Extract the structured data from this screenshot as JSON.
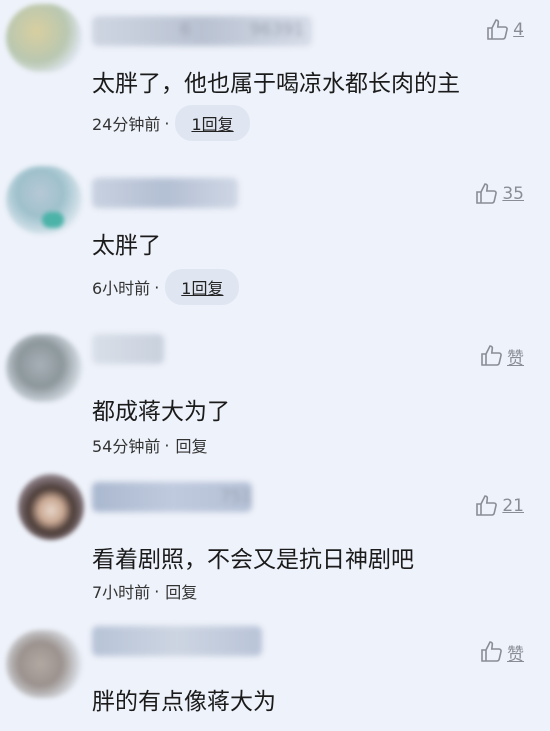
{
  "comments": [
    {
      "user_fragment": "6",
      "user_fragment2": "96391",
      "text": "太胖了，他也属于喝凉水都长肉的主",
      "time": "24分钟前",
      "reply": "1回复",
      "likes": "4",
      "reply_style": "pill"
    },
    {
      "text": "太胖了",
      "time": "6小时前",
      "reply": "1回复",
      "likes": "35",
      "reply_style": "pill"
    },
    {
      "text": "都成蒋大为了",
      "time": "54分钟前",
      "reply": "回复",
      "likes": "赞",
      "reply_style": "plain"
    },
    {
      "user_fragment": "751",
      "text": "看着剧照，不会又是抗日神剧吧",
      "time": "7小时前",
      "reply": "回复",
      "likes": "21",
      "reply_style": "plain"
    },
    {
      "text": "胖的有点像蒋大为",
      "time": "",
      "reply": "",
      "likes": "赞",
      "reply_style": "plain"
    }
  ],
  "colors": {
    "background": "#eef2fa",
    "muted": "#8a8d96",
    "pill": "#e0e6f1"
  },
  "icons": {
    "like": "thumbs-up-icon"
  }
}
